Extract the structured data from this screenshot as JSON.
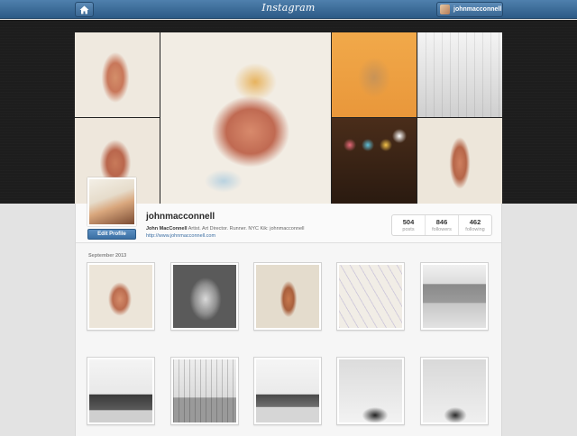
{
  "topbar": {
    "logo": "Instagram",
    "username": "johnmacconnell"
  },
  "profile": {
    "username": "johnmacconnell",
    "full_name": "John MacConnell",
    "bio": "Artist. Art Director. Runner. NYC Kik: johnmacconnell",
    "website": "http://www.johnmacconnell.com",
    "edit_label": "Edit Profile"
  },
  "stats": [
    {
      "value": "504",
      "label": "posts"
    },
    {
      "value": "846",
      "label": "followers"
    },
    {
      "value": "462",
      "label": "following"
    }
  ],
  "feed": {
    "month": "September 2013"
  },
  "icons": [
    "home-icon",
    "user-avatar-icon"
  ],
  "colors": {
    "topbar": "#3a6793",
    "link": "#3b6ea3",
    "edit_button": "#4a7fb2"
  }
}
